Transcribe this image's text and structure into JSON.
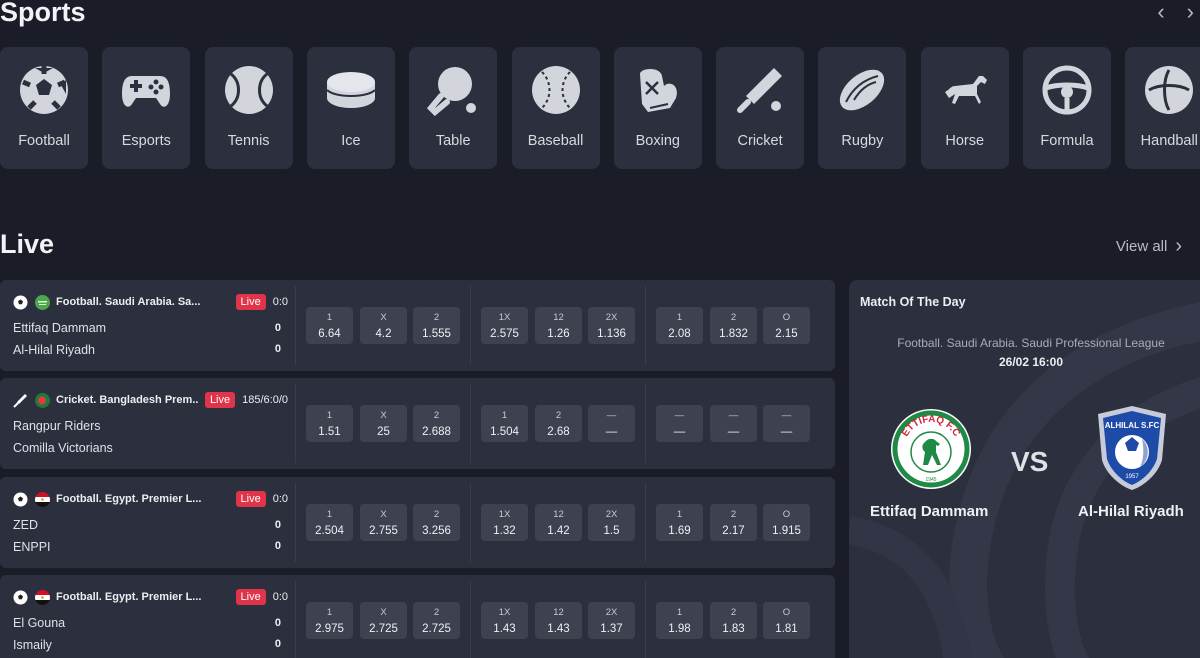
{
  "sports": {
    "title": "Sports",
    "prev_arrow": "‹",
    "next_arrow": "›",
    "items": [
      {
        "label": "Football",
        "icon": "football-icon"
      },
      {
        "label": "Esports",
        "icon": "gamepad-icon"
      },
      {
        "label": "Tennis",
        "icon": "tennis-ball-icon"
      },
      {
        "label": "Ice",
        "icon": "ice-puck-icon"
      },
      {
        "label": "Table",
        "icon": "table-tennis-icon"
      },
      {
        "label": "Baseball",
        "icon": "baseball-icon"
      },
      {
        "label": "Boxing",
        "icon": "boxing-glove-icon"
      },
      {
        "label": "Cricket",
        "icon": "cricket-bat-icon"
      },
      {
        "label": "Rugby",
        "icon": "rugby-ball-icon"
      },
      {
        "label": "Horse",
        "icon": "horse-icon"
      },
      {
        "label": "Formula",
        "icon": "steering-wheel-icon"
      },
      {
        "label": "Handball",
        "icon": "handball-icon"
      }
    ]
  },
  "live": {
    "title": "Live",
    "view_all": "View all",
    "view_all_arrow": "›",
    "matches": [
      {
        "sport_icon": "football-icon",
        "flag": "saudi-arabia",
        "league": "Football. Saudi Arabia. Sa...",
        "live_label": "Live",
        "score": "0:0",
        "team1": "Ettifaq Dammam",
        "team2": "Al-Hilal Riyadh",
        "score1": "0",
        "score2": "0",
        "odds": [
          {
            "label": "1",
            "value": "6.64"
          },
          {
            "label": "X",
            "value": "4.2"
          },
          {
            "label": "2",
            "value": "1.555"
          },
          {
            "label": "1X",
            "value": "2.575"
          },
          {
            "label": "12",
            "value": "1.26"
          },
          {
            "label": "2X",
            "value": "1.136"
          },
          {
            "label": "1",
            "value": "2.08"
          },
          {
            "label": "2",
            "value": "1.832"
          },
          {
            "label": "O",
            "value": "2.15"
          }
        ]
      },
      {
        "sport_icon": "cricket-bat-icon",
        "flag": "bangladesh",
        "league": "Cricket. Bangladesh Prem...",
        "live_label": "Live",
        "score": "185/6:0/0",
        "team1": "Rangpur Riders",
        "team2": "Comilla Victorians",
        "score1": "",
        "score2": "",
        "odds": [
          {
            "label": "1",
            "value": "1.51"
          },
          {
            "label": "X",
            "value": "25"
          },
          {
            "label": "2",
            "value": "2.688"
          },
          {
            "label": "1",
            "value": "1.504"
          },
          {
            "label": "2",
            "value": "2.68"
          },
          {
            "label": "—",
            "value": "—"
          },
          {
            "label": "—",
            "value": "—"
          },
          {
            "label": "—",
            "value": "—"
          },
          {
            "label": "—",
            "value": "—"
          }
        ]
      },
      {
        "sport_icon": "football-icon",
        "flag": "egypt",
        "league": "Football. Egypt. Premier L...",
        "live_label": "Live",
        "score": "0:0",
        "team1": "ZED",
        "team2": "ENPPI",
        "score1": "0",
        "score2": "0",
        "odds": [
          {
            "label": "1",
            "value": "2.504"
          },
          {
            "label": "X",
            "value": "2.755"
          },
          {
            "label": "2",
            "value": "3.256"
          },
          {
            "label": "1X",
            "value": "1.32"
          },
          {
            "label": "12",
            "value": "1.42"
          },
          {
            "label": "2X",
            "value": "1.5"
          },
          {
            "label": "1",
            "value": "1.69"
          },
          {
            "label": "2",
            "value": "2.17"
          },
          {
            "label": "O",
            "value": "1.915"
          }
        ]
      },
      {
        "sport_icon": "football-icon",
        "flag": "egypt",
        "league": "Football. Egypt. Premier L...",
        "live_label": "Live",
        "score": "0:0",
        "team1": "El Gouna",
        "team2": "Ismaily",
        "score1": "0",
        "score2": "0",
        "odds": [
          {
            "label": "1",
            "value": "2.975"
          },
          {
            "label": "X",
            "value": "2.725"
          },
          {
            "label": "2",
            "value": "2.725"
          },
          {
            "label": "1X",
            "value": "1.43"
          },
          {
            "label": "12",
            "value": "1.43"
          },
          {
            "label": "2X",
            "value": "1.37"
          },
          {
            "label": "1",
            "value": "1.98"
          },
          {
            "label": "2",
            "value": "1.83"
          },
          {
            "label": "O",
            "value": "1.81"
          }
        ]
      }
    ]
  },
  "match_of_the_day": {
    "title": "Match Of The Day",
    "league": "Football. Saudi Arabia. Saudi Professional League",
    "datetime": "26/02 16:00",
    "vs": "VS",
    "home": {
      "name": "Ettifaq Dammam",
      "logo_text": "ETTIFAQ F.C",
      "logo_year": "1945",
      "logo_icon": "ettifaq-crest-icon"
    },
    "away": {
      "name": "Al-Hilal Riyadh",
      "logo_text": "ALHILAL S.FC",
      "logo_year": "1957",
      "logo_icon": "al-hilal-crest-icon"
    }
  },
  "colors": {
    "background": "#1a1d28",
    "card": "#2c2f3d",
    "odd_button": "#3d4150",
    "live_badge": "#e0344a"
  }
}
